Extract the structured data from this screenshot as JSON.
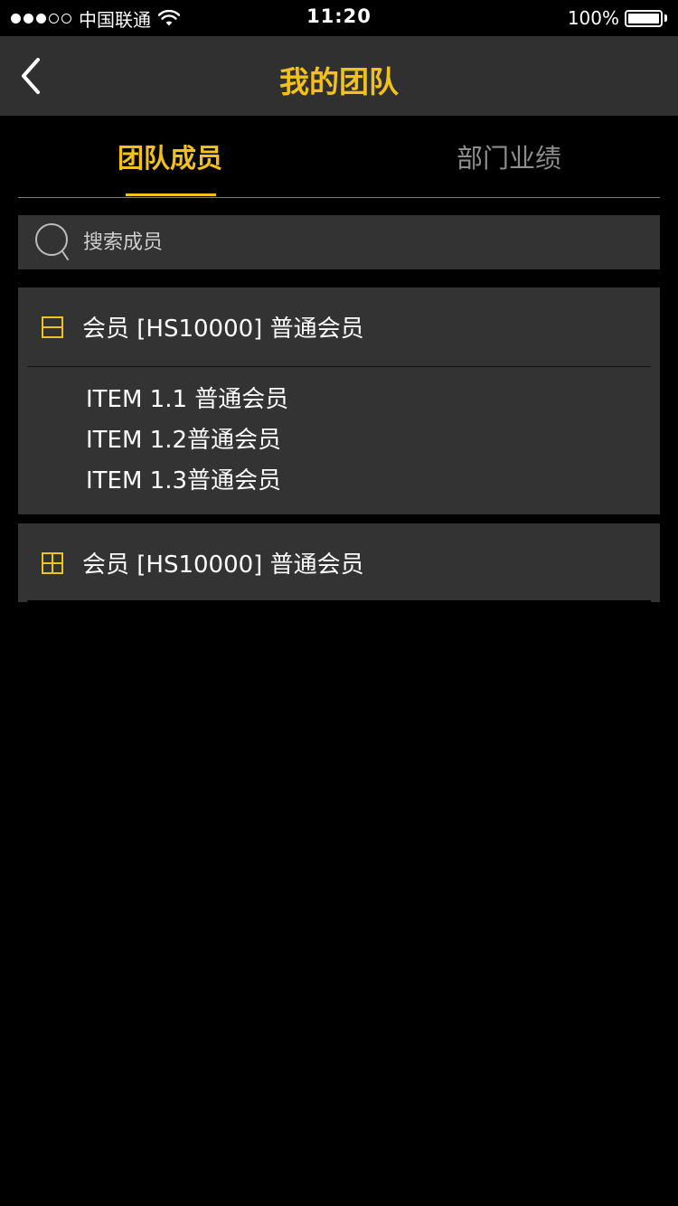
{
  "status_bar": {
    "carrier": "中国联通",
    "time": "11:20",
    "battery": "100%",
    "signal_bars_filled": 3,
    "signal_bars_total": 5
  },
  "nav": {
    "title": "我的团队",
    "back_icon": "chevron-left-icon"
  },
  "tabs": [
    {
      "label": "团队成员",
      "active": true
    },
    {
      "label": "部门业绩",
      "active": false
    }
  ],
  "search": {
    "placeholder": "搜索成员",
    "value": ""
  },
  "groups": [
    {
      "title": "会员 [HS10000] 普通会员",
      "expanded": true,
      "toggle_icon": "collapse-minus-icon",
      "items": [
        "ITEM 1.1 普通会员",
        "ITEM 1.2普通会员",
        "ITEM 1.3普通会员"
      ]
    },
    {
      "title": "会员 [HS10000] 普通会员",
      "expanded": false,
      "toggle_icon": "expand-plus-icon",
      "items": []
    }
  ],
  "colors": {
    "accent": "#f2c21b",
    "background": "#000000",
    "panel": "#333333",
    "nav": "#303030",
    "inactive_tab": "#8d8d8d"
  }
}
